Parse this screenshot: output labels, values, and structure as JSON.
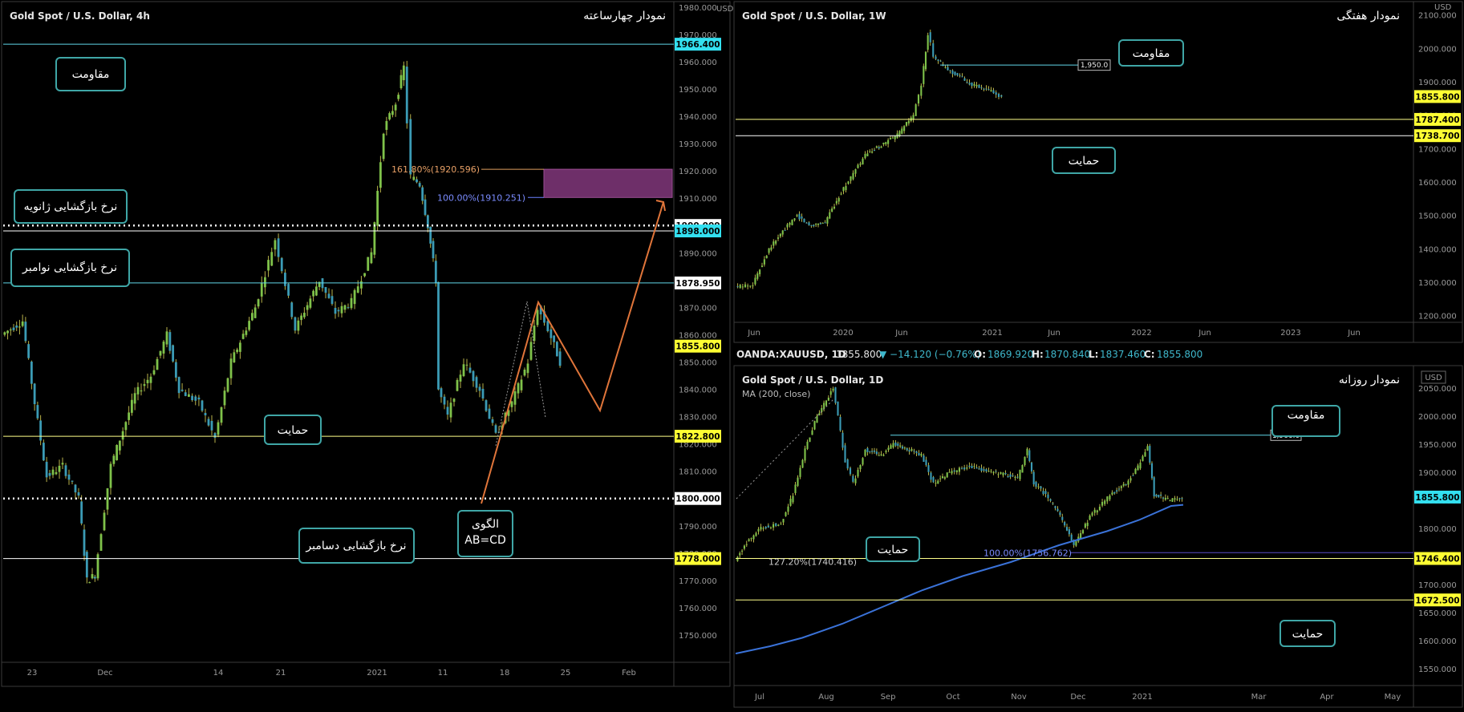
{
  "colors": {
    "background": "#000000",
    "up": "#7fc24a",
    "down": "#3b9bb5",
    "wick": "#b8b24a",
    "cyan_line": "#5fd6e8",
    "yellow_line": "#ffff8a",
    "white_line": "#ffffff",
    "ma_line": "#3a72d8",
    "fib_zone": "#6e2f69",
    "pattern_line": "#e0753a",
    "callout_border": "#3fa6a6",
    "tag_yellow": "#ffff33",
    "tag_cyan": "#33e0f0",
    "tag_white": "#ffffff"
  },
  "info_bar": {
    "symbol": "OANDA:XAUUSD, 1D",
    "price": "1855.800",
    "change": "▼ −14.120 (−0.76%)",
    "o_label": "O:",
    "o_value": "1869.920",
    "h_label": "H:",
    "h_value": "1870.840",
    "l_label": "L:",
    "l_value": "1837.460",
    "c_label": "C:",
    "c_value": "1855.800"
  },
  "chart_data": [
    {
      "id": "four_hour",
      "type": "candlestick",
      "title": "Gold Spot / U.S. Dollar, 4h",
      "subtitle": "نمودار چهارساعته",
      "currency": "USD",
      "ylim": [
        1740,
        1982
      ],
      "y_ticks": [
        "1980.000",
        "1970.000",
        "1960.000",
        "1950.000",
        "1940.000",
        "1930.000",
        "1920.000",
        "1910.000",
        "1900.000",
        "1890.000",
        "1880.000",
        "1870.000",
        "1860.000",
        "1850.000",
        "1840.000",
        "1830.000",
        "1820.000",
        "1810.000",
        "1800.000",
        "1790.000",
        "1780.000",
        "1770.000",
        "1760.000",
        "1750.000"
      ],
      "x_ticks": [
        "23",
        "Dec",
        "14",
        "21",
        "2021",
        "11",
        "18",
        "25",
        "Feb"
      ],
      "levels": [
        {
          "value": 1966.4,
          "label": "1966.400",
          "tag": "cyan",
          "line": "cyan"
        },
        {
          "value": 1900.0,
          "label": "1900.000",
          "tag": "white",
          "line": "dotted"
        },
        {
          "value": 1898.0,
          "label": "1898.000",
          "tag": "cyan",
          "line": "white"
        },
        {
          "value": 1878.95,
          "label": "1878.950",
          "tag": "white",
          "line": "cyan"
        },
        {
          "value": 1855.8,
          "label": "1855.800",
          "tag": "yellow",
          "line": "none"
        },
        {
          "value": 1822.8,
          "label": "1822.800",
          "tag": "yellow",
          "line": "yellow"
        },
        {
          "value": 1800.0,
          "label": "1800.000",
          "tag": "white",
          "line": "dotted"
        },
        {
          "value": 1778.0,
          "label": "1778.000",
          "tag": "yellow",
          "line": "white"
        }
      ],
      "fib_zone": {
        "top": 1920.596,
        "bottom": 1910.251,
        "top_label": "161.80%(1920.596)",
        "bottom_label": "100.00%(1910.251)"
      },
      "callouts": [
        {
          "text": "مقاومت"
        },
        {
          "text": "نرخ بازگشایی ژانویه"
        },
        {
          "text": "نرخ بازگشایی نوامبر"
        },
        {
          "text": "حمایت"
        },
        {
          "text": "نرخ بازگشایی دسامبر"
        },
        {
          "text": "الگوی",
          "text2": "AB=CD"
        }
      ],
      "series": [
        {
          "name": "",
          "x": [
            "23",
            "Dec",
            "14",
            "21",
            "2021",
            "11",
            "18",
            "25"
          ],
          "close": [
            1870,
            1805,
            1840,
            1875,
            1945,
            1835,
            1840,
            1855
          ]
        }
      ]
    },
    {
      "id": "weekly",
      "type": "candlestick",
      "title": "Gold Spot / U.S. Dollar, 1W",
      "subtitle": "نمودار هفتگی",
      "currency": "USD",
      "ylim": [
        1180,
        2140
      ],
      "y_ticks": [
        "2100.000",
        "2000.000",
        "1900.000",
        "1800.000",
        "1700.000",
        "1600.000",
        "1500.000",
        "1400.000",
        "1300.000",
        "1200.000"
      ],
      "x_ticks": [
        "Jun",
        "2020",
        "Jun",
        "2021",
        "Jun",
        "2022",
        "Jun",
        "2023",
        "Jun"
      ],
      "levels": [
        {
          "value": 1855.8,
          "label": "1855.800",
          "tag": "yellow",
          "line": "none"
        },
        {
          "value": 1787.4,
          "label": "1787.400",
          "tag": "yellow",
          "line": "yellow"
        },
        {
          "value": 1738.7,
          "label": "1738.700",
          "tag": "yellow",
          "line": "white"
        }
      ],
      "resistance_tag": {
        "value": 1950.0,
        "label": "1,950.0"
      },
      "callouts": [
        {
          "text": "مقاومت"
        },
        {
          "text": "حمایت"
        }
      ],
      "series": [
        {
          "name": "",
          "x": [
            "Jun 2019",
            "2020",
            "Jun 2020",
            "Aug 2020",
            "2021"
          ],
          "close": [
            1290,
            1530,
            1740,
            2040,
            1855
          ]
        }
      ]
    },
    {
      "id": "daily",
      "type": "candlestick",
      "title": "Gold Spot / U.S. Dollar, 1D",
      "subtitle": "نمودار روزانه",
      "indicator": "MA (200, close)",
      "currency": "USD",
      "ylim": [
        1520,
        2090
      ],
      "y_ticks": [
        "2050.000",
        "2000.000",
        "1950.000",
        "1900.000",
        "1850.000",
        "1800.000",
        "1750.000",
        "1700.000",
        "1650.000",
        "1600.000",
        "1550.000"
      ],
      "x_ticks": [
        "Jul",
        "Aug",
        "Sep",
        "Oct",
        "Nov",
        "Dec",
        "2021",
        "Mar",
        "Apr",
        "May"
      ],
      "levels": [
        {
          "value": 1855.8,
          "label": "1855.800",
          "tag": "cyan",
          "line": "none"
        },
        {
          "value": 1746.4,
          "label": "1746.400",
          "tag": "yellow",
          "line": "yellow"
        },
        {
          "value": 1672.5,
          "label": "1672.500",
          "tag": "yellow",
          "line": "yellow"
        }
      ],
      "resistance_tag": {
        "value": 1966.0,
        "label": "1,966.0"
      },
      "fib_labels": [
        {
          "value": 1756.762,
          "label": "100.00%(1756.762)"
        },
        {
          "value": 1740.416,
          "label": "127.20%(1740.416)"
        }
      ],
      "callouts": [
        {
          "text": "مقاومت"
        },
        {
          "text": "حمایت"
        },
        {
          "text": "حمایت"
        }
      ],
      "series": [
        {
          "name": "",
          "x": [
            "Jul",
            "Aug",
            "Sep",
            "Oct",
            "Nov",
            "Dec",
            "2021"
          ],
          "close": [
            1770,
            2060,
            1960,
            1890,
            1950,
            1780,
            1855
          ]
        }
      ]
    }
  ]
}
